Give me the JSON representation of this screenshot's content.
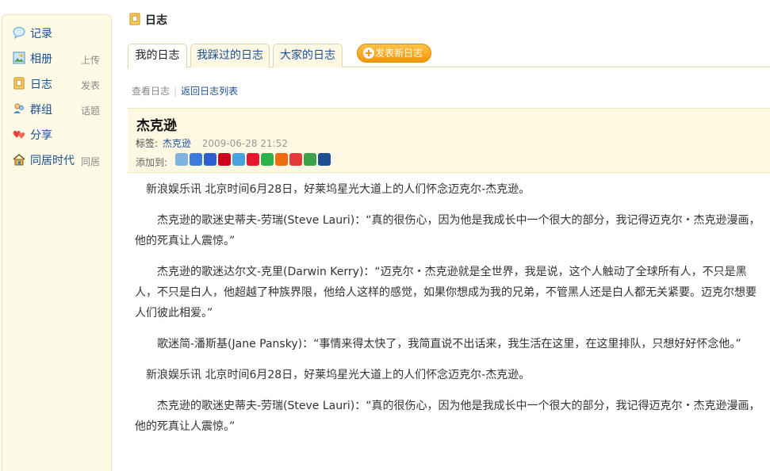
{
  "sidebar": {
    "items": [
      {
        "label": "记录",
        "sub": ""
      },
      {
        "label": "相册",
        "sub": "上传"
      },
      {
        "label": "日志",
        "sub": "发表"
      },
      {
        "label": "群组",
        "sub": "话题"
      },
      {
        "label": "分享",
        "sub": ""
      },
      {
        "label": "同居时代",
        "sub": "同居"
      }
    ]
  },
  "header": {
    "title": "日志"
  },
  "tabs": [
    {
      "label": "我的日志"
    },
    {
      "label": "我踩过的日志"
    },
    {
      "label": "大家的日志"
    }
  ],
  "publish_label": "发表新日志",
  "breadcrumb": {
    "current": "查看日志",
    "link": "返回日志列表"
  },
  "post": {
    "title": "杰克逊",
    "tag_label": "标签:",
    "tag": "杰克逊",
    "date": "2009-06-28 21:52",
    "addto_label": "添加到:",
    "share_icons": [
      {
        "name": "bookmark-icon",
        "color": "#7fb3e0"
      },
      {
        "name": "google-icon",
        "color": "#3b7be0"
      },
      {
        "name": "baidu-icon",
        "color": "#2b5fd0"
      },
      {
        "name": "yahoo-icon",
        "color": "#d0021b"
      },
      {
        "name": "qzone-icon",
        "color": "#4aa3df"
      },
      {
        "name": "weibo-icon",
        "color": "#e6162d"
      },
      {
        "name": "douban-icon",
        "color": "#2bb24c"
      },
      {
        "name": "renren-icon",
        "color": "#f06a0f"
      },
      {
        "name": "cpolar-icon",
        "color": "#e33b3b"
      },
      {
        "name": "kaixin-icon",
        "color": "#3aa34a"
      },
      {
        "name": "digg-icon",
        "color": "#1a4f94"
      }
    ],
    "paragraphs": [
      "新浪娱乐讯 北京时间6月28日，好莱坞星光大道上的人们怀念迈克尔-杰克逊。",
      "杰克逊的歌迷史蒂夫-劳瑞(Steve Lauri)：“真的很伤心，因为他是我成长中一个很大的部分，我记得迈克尔・杰克逊漫画，他的死真让人震惊。”",
      "杰克逊的歌迷达尔文-克里(Darwin Kerry)：“迈克尔・杰克逊就是全世界，我是说，这个人触动了全球所有人，不只是黑人，不只是白人，他超越了种族界限，他给人这样的感觉，如果你想成为我的兄弟，不管黑人还是白人都无关紧要。迈克尔想要人们彼此相爱。”",
      "歌迷简-潘斯基(Jane Pansky)：“事情来得太快了，我简直说不出话来，我生活在这里，在这里排队，只想好好怀念他。”",
      "新浪娱乐讯 北京时间6月28日，好莱坞星光大道上的人们怀念迈克尔-杰克逊。",
      "杰克逊的歌迷史蒂夫-劳瑞(Steve Lauri)：“真的很伤心，因为他是我成长中一个很大的部分，我记得迈克尔・杰克逊漫画，他的死真让人震惊。”"
    ]
  }
}
